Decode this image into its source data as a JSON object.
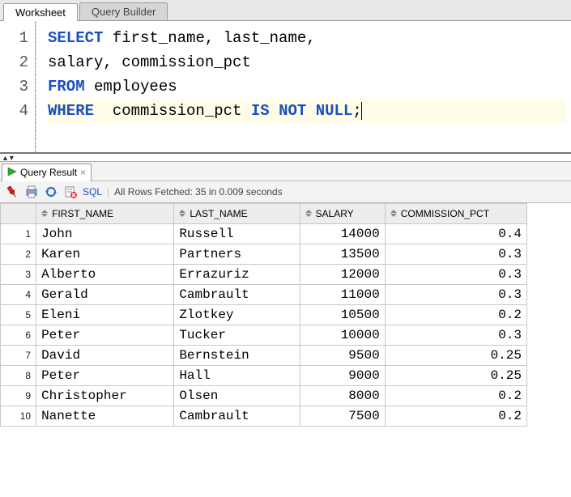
{
  "tabs": {
    "worksheet": "Worksheet",
    "query_builder": "Query Builder"
  },
  "editor": {
    "line_numbers": [
      "1",
      "2",
      "3",
      "4"
    ],
    "lines": [
      {
        "tokens": [
          {
            "t": "SELECT",
            "c": "kw"
          },
          {
            "t": " first_name, last_name, ",
            "c": ""
          }
        ]
      },
      {
        "tokens": [
          {
            "t": "salary, commission_pct",
            "c": ""
          }
        ]
      },
      {
        "tokens": [
          {
            "t": "FROM",
            "c": "kw"
          },
          {
            "t": " employees",
            "c": ""
          }
        ]
      },
      {
        "tokens": [
          {
            "t": "WHERE",
            "c": "kw"
          },
          {
            "t": "  commission_pct ",
            "c": ""
          },
          {
            "t": "IS",
            "c": "kw"
          },
          {
            "t": " ",
            "c": ""
          },
          {
            "t": "NOT",
            "c": "kw"
          },
          {
            "t": " ",
            "c": ""
          },
          {
            "t": "NULL",
            "c": "kw"
          },
          {
            "t": ";",
            "c": ""
          }
        ],
        "highlight": true,
        "caret": true
      }
    ]
  },
  "result_tab": {
    "label": "Query Result"
  },
  "toolbar": {
    "sql_label": "SQL",
    "status": "All Rows Fetched: 35 in 0.009 seconds"
  },
  "columns": [
    "FIRST_NAME",
    "LAST_NAME",
    "SALARY",
    "COMMISSION_PCT"
  ],
  "col_align": [
    "txt",
    "txt",
    "num",
    "num"
  ],
  "rows": [
    [
      "John",
      "Russell",
      "14000",
      "0.4"
    ],
    [
      "Karen",
      "Partners",
      "13500",
      "0.3"
    ],
    [
      "Alberto",
      "Errazuriz",
      "12000",
      "0.3"
    ],
    [
      "Gerald",
      "Cambrault",
      "11000",
      "0.3"
    ],
    [
      "Eleni",
      "Zlotkey",
      "10500",
      "0.2"
    ],
    [
      "Peter",
      "Tucker",
      "10000",
      "0.3"
    ],
    [
      "David",
      "Bernstein",
      "9500",
      "0.25"
    ],
    [
      "Peter",
      "Hall",
      "9000",
      "0.25"
    ],
    [
      "Christopher",
      "Olsen",
      "8000",
      "0.2"
    ],
    [
      "Nanette",
      "Cambrault",
      "7500",
      "0.2"
    ]
  ]
}
